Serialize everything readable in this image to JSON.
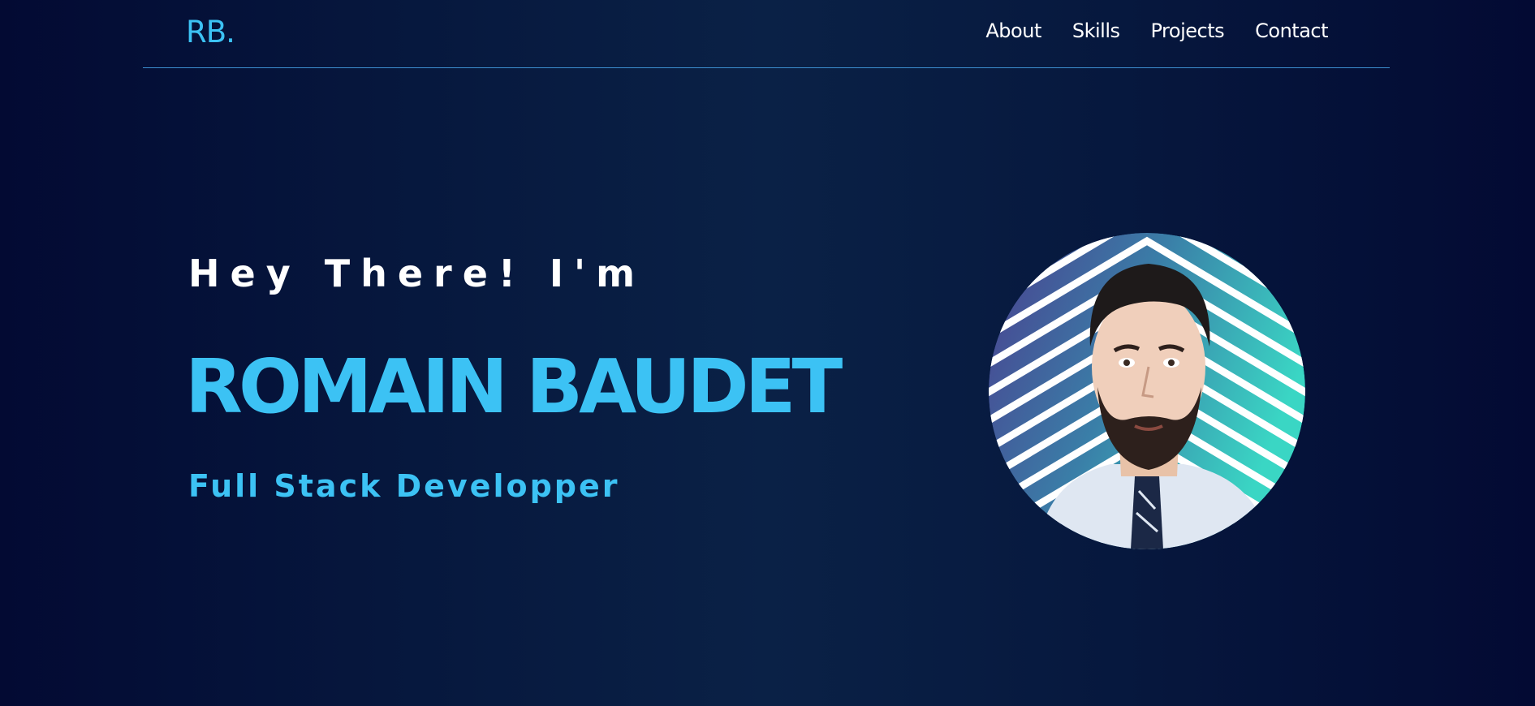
{
  "nav": {
    "logo": "RB.",
    "links": [
      "About",
      "Skills",
      "Projects",
      "Contact"
    ]
  },
  "hero": {
    "greeting": "Hey There! I'm",
    "name": "ROMAIN BAUDET",
    "role": "Full Stack Developper"
  },
  "colors": {
    "accent": "#3cc2f4",
    "text": "#ffffff",
    "background": "#06173d",
    "divider": "#3d8fd0"
  }
}
